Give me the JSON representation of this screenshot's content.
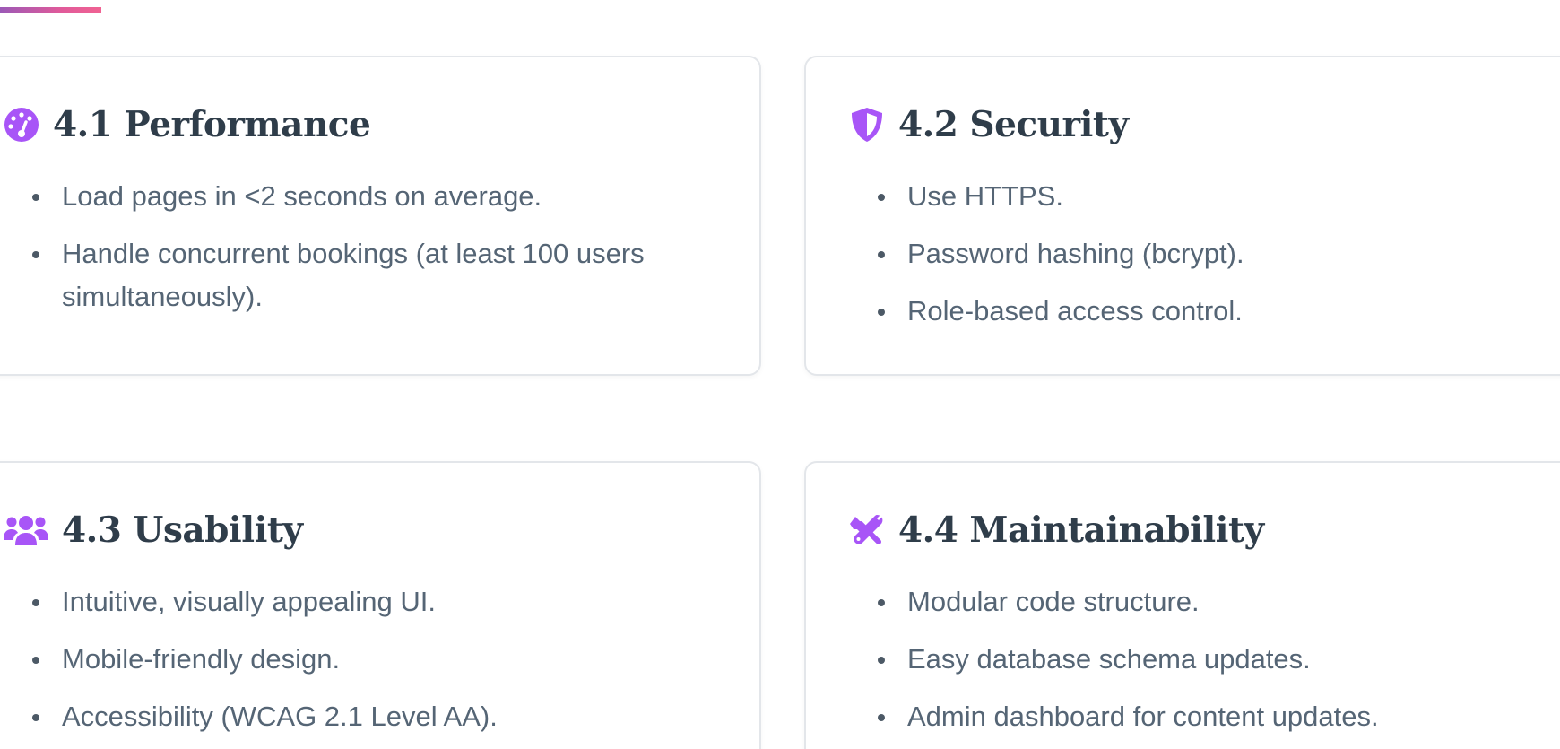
{
  "colors": {
    "accent": "#a855f7",
    "heading": "#2f3d4a",
    "body_text": "#556575",
    "border": "#e3e6ea"
  },
  "cards": [
    {
      "icon": "gauge-icon",
      "title": "4.1 Performance",
      "items": [
        "Load pages in <2 seconds on average.",
        "Handle concurrent bookings (at least 100 users simultaneously)."
      ]
    },
    {
      "icon": "shield-icon",
      "title": "4.2 Security",
      "items": [
        "Use HTTPS.",
        "Password hashing (bcrypt).",
        "Role-based access control."
      ]
    },
    {
      "icon": "users-icon",
      "title": "4.3 Usability",
      "items": [
        "Intuitive, visually appealing UI.",
        "Mobile-friendly design.",
        "Accessibility (WCAG 2.1 Level AA)."
      ]
    },
    {
      "icon": "tools-icon",
      "title": "4.4 Maintainability",
      "items": [
        "Modular code structure.",
        "Easy database schema updates.",
        "Admin dashboard for content updates."
      ]
    }
  ]
}
